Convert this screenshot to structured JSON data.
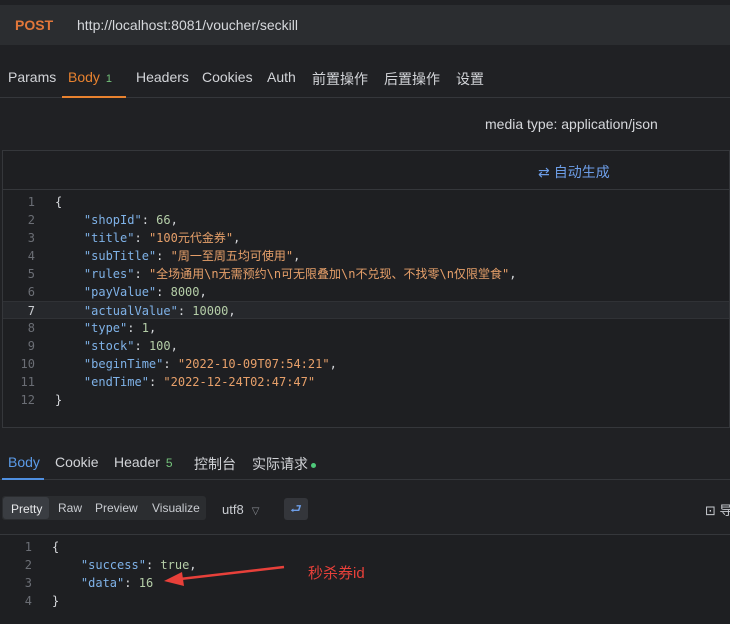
{
  "request": {
    "method": "POST",
    "url": "http://localhost:8081/voucher/seckill"
  },
  "req_tabs": [
    {
      "label": "Params"
    },
    {
      "label": "Body",
      "badge": "1"
    },
    {
      "label": "Headers"
    },
    {
      "label": "Cookies"
    },
    {
      "label": "Auth"
    },
    {
      "label": "前置操作"
    },
    {
      "label": "后置操作"
    },
    {
      "label": "设置"
    }
  ],
  "media_type": "media type: application/json",
  "auto_generate": "自动生成",
  "request_body": [
    {
      "num": "1",
      "text": "{"
    },
    {
      "num": "2",
      "key": "\"shopId\"",
      "value": "66",
      "vtype": "n"
    },
    {
      "num": "3",
      "key": "\"title\"",
      "value": "\"100元代金券\"",
      "vtype": "s"
    },
    {
      "num": "4",
      "key": "\"subTitle\"",
      "value": "\"周一至周五均可使用\"",
      "vtype": "s"
    },
    {
      "num": "5",
      "key": "\"rules\"",
      "value": "\"全场通用\\n无需预约\\n可无限叠加\\n不兑现、不找零\\n仅限堂食\"",
      "vtype": "s"
    },
    {
      "num": "6",
      "key": "\"payValue\"",
      "value": "8000",
      "vtype": "n"
    },
    {
      "num": "7",
      "key": "\"actualValue\"",
      "value": "10000",
      "vtype": "n"
    },
    {
      "num": "8",
      "key": "\"type\"",
      "value": "1",
      "vtype": "n"
    },
    {
      "num": "9",
      "key": "\"stock\"",
      "value": "100",
      "vtype": "n"
    },
    {
      "num": "10",
      "key": "\"beginTime\"",
      "value": "\"2022-10-09T07:54:21\"",
      "vtype": "s"
    },
    {
      "num": "11",
      "key": "\"endTime\"",
      "value": "\"2022-12-24T02:47:47\"",
      "vtype": "s",
      "last": true
    },
    {
      "num": "12",
      "text": "}"
    }
  ],
  "resp_tabs": [
    {
      "label": "Body"
    },
    {
      "label": "Cookie"
    },
    {
      "label": "Header",
      "badge": "5"
    },
    {
      "label": "控制台"
    },
    {
      "label": "实际请求"
    }
  ],
  "view_modes": [
    "Pretty",
    "Raw",
    "Preview",
    "Visualize"
  ],
  "encoding": "utf8",
  "export_label": "导出",
  "response_body": [
    {
      "num": "1",
      "text": "{"
    },
    {
      "num": "2",
      "key": "\"success\"",
      "value": "true",
      "vtype": "n"
    },
    {
      "num": "3",
      "key": "\"data\"",
      "value": "16",
      "vtype": "n",
      "last": true
    },
    {
      "num": "4",
      "text": "}"
    }
  ],
  "annotation": "秒杀券id"
}
